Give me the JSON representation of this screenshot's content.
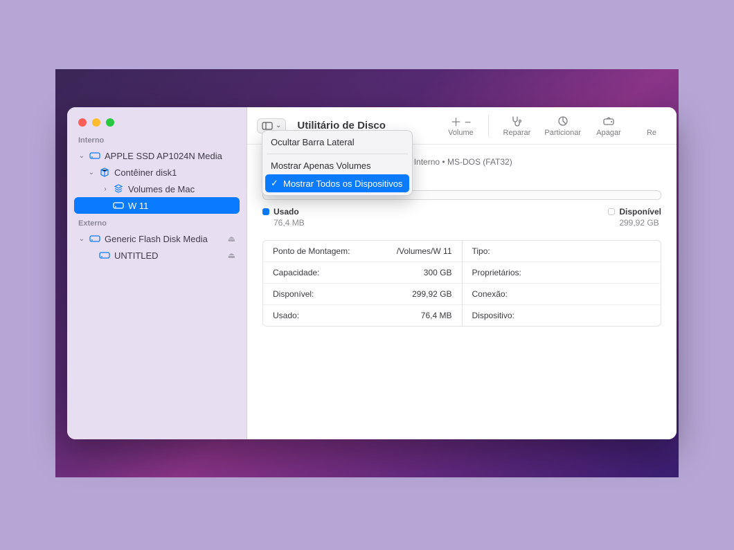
{
  "window": {
    "title": "Utilitário de Disco"
  },
  "sidebar": {
    "section_internal": "Interno",
    "section_external": "Externo",
    "internal": {
      "disk0": "APPLE SSD AP1024N Media",
      "container": "Contêiner disk1",
      "mac_volumes": "Volumes de Mac",
      "w11": "W 11"
    },
    "external": {
      "disk": "Generic Flash Disk Media",
      "vol": "UNTITLED"
    }
  },
  "toolbar": {
    "volume": "Volume",
    "repair": "Reparar",
    "partition": "Particionar",
    "erase": "Apagar",
    "restore": "Re"
  },
  "menu": {
    "hide_sidebar": "Ocultar Barra Lateral",
    "show_volumes": "Mostrar Apenas Volumes",
    "show_all": "Mostrar Todos os Dispositivos"
  },
  "detail": {
    "meta": "PCI Express Volume Físico Interno • MS-DOS (FAT32)",
    "used_label": "Usado",
    "used_value": "76,4 MB",
    "free_label": "Disponível",
    "free_value": "299,92 GB",
    "rows_left": [
      {
        "k": "Ponto de Montagem:",
        "v": "/Volumes/W 11"
      },
      {
        "k": "Capacidade:",
        "v": "300 GB"
      },
      {
        "k": "Disponível:",
        "v": "299,92 GB"
      },
      {
        "k": "Usado:",
        "v": "76,4 MB"
      }
    ],
    "rows_right": [
      {
        "k": "Tipo:",
        "v": ""
      },
      {
        "k": "Proprietários:",
        "v": ""
      },
      {
        "k": "Conexão:",
        "v": ""
      },
      {
        "k": "Dispositivo:",
        "v": ""
      }
    ]
  }
}
